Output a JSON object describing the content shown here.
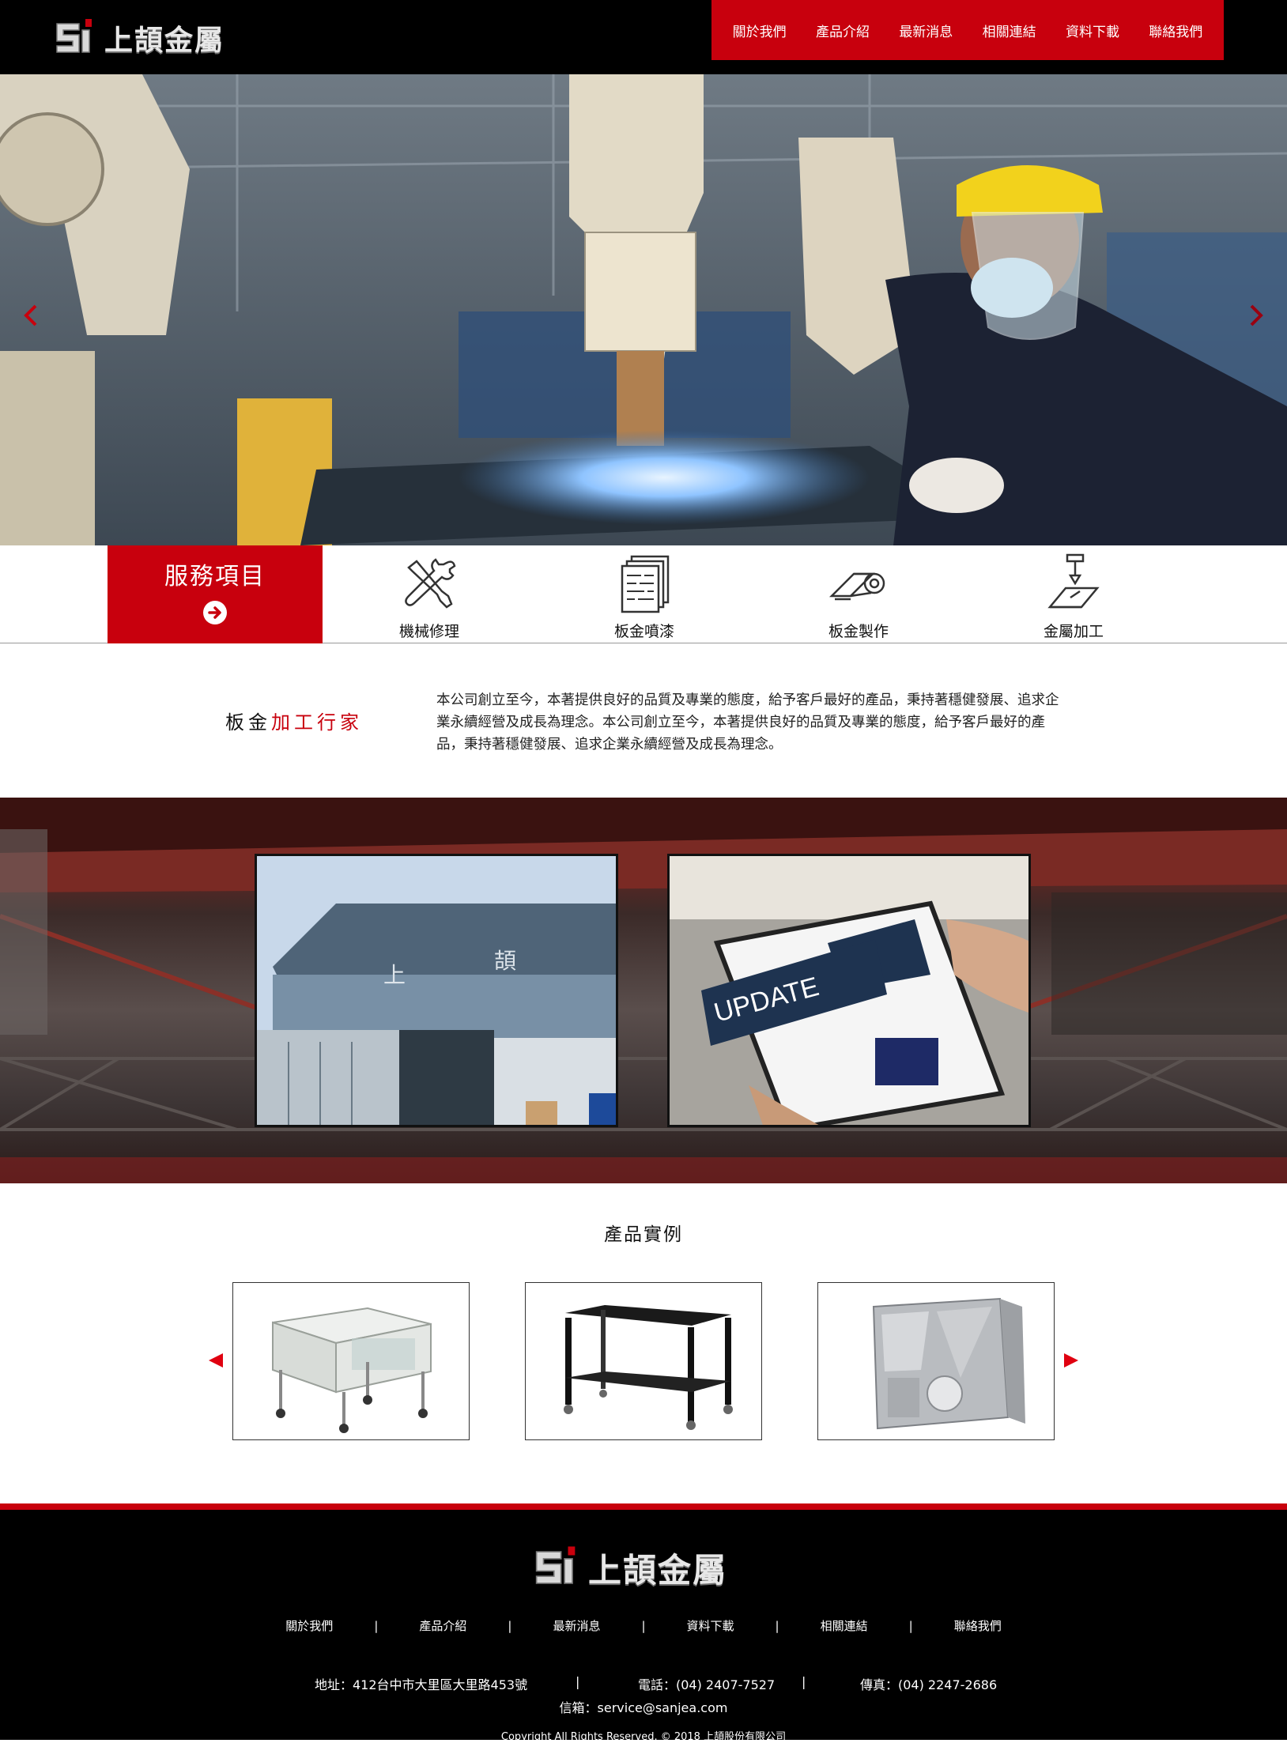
{
  "header": {
    "logo_text": "上頡金屬",
    "nav": [
      "關於我們",
      "產品介紹",
      "最新消息",
      "相關連結",
      "資料下載",
      "聯絡我們"
    ]
  },
  "hero": {
    "prev_icon": "chevron-left-icon",
    "next_icon": "chevron-right-icon"
  },
  "services": {
    "title": "服務項目",
    "go_icon": "arrow-circle-right-icon",
    "items": [
      {
        "label": "機械修理",
        "icon": "tools-wrench-icon"
      },
      {
        "label": "板金噴漆",
        "icon": "stacked-sheets-icon"
      },
      {
        "label": "板金製作",
        "icon": "rolled-metal-icon"
      },
      {
        "label": "金屬加工",
        "icon": "press-machine-icon"
      }
    ]
  },
  "intro": {
    "heading_plain": "板金",
    "heading_red": "加工行家",
    "text": "本公司創立至今，本著提供良好的品質及專業的態度，給予客戶最好的產品，秉持著穩健發展、追求企業永續經營及成長為理念。本公司創立至今，本著提供良好的品質及專業的態度，給予客戶最好的產品，秉持著穩健發展、追求企業永續經營及成長為理念。"
  },
  "cards": {
    "factory_sign_chars": [
      "上",
      "頡"
    ],
    "update_text": "UPDATE"
  },
  "products": {
    "title": "產品實例",
    "prev_icon": "triangle-left-icon",
    "next_icon": "triangle-right-icon"
  },
  "footer": {
    "logo_text": "上頡金屬",
    "nav": [
      "關於我們",
      "產品介紹",
      "最新消息",
      "資料下載",
      "相關連結",
      "聯絡我們"
    ],
    "separator": "|",
    "address": "地址：412台中市大里區大里路453號",
    "phone": "電話：(04) 2407-7527",
    "fax": "傳真：(04) 2247-2686",
    "email": "信箱：service@sanjea.com",
    "copyright": "Copyright All Rights Reserved. © 2018 上頡股份有限公司"
  },
  "colors": {
    "brand_red": "#c8000d",
    "header_bg": "#000000",
    "footer_bg": "#000000"
  }
}
